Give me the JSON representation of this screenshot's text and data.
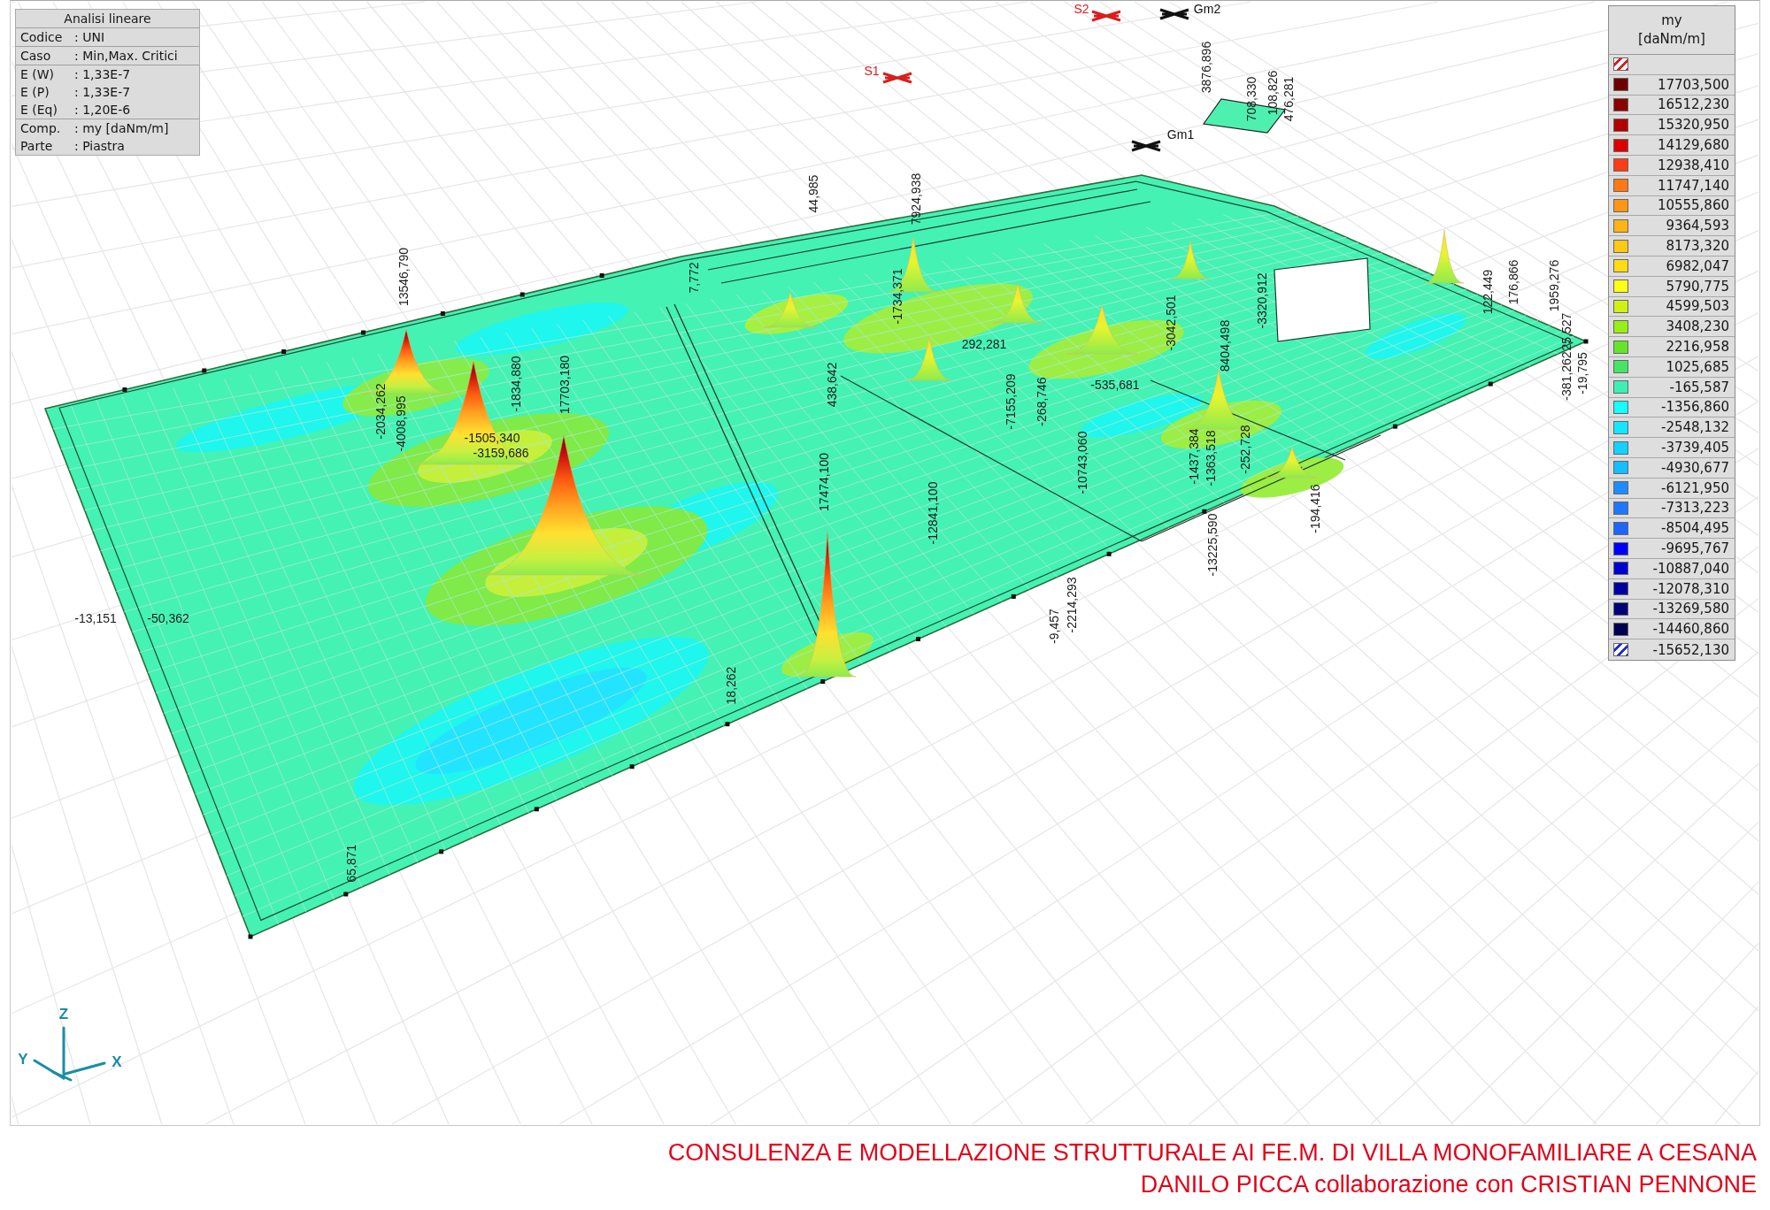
{
  "info_panel": {
    "title": "Analisi lineare",
    "groups": [
      [
        {
          "label": "Codice",
          "value": ": UNI"
        }
      ],
      [
        {
          "label": "Caso",
          "value": ": Min,Max. Critici"
        }
      ],
      [
        {
          "label": "E (W)",
          "value": ": 1,33E-7"
        },
        {
          "label": "E (P)",
          "value": ": 1,33E-7"
        },
        {
          "label": "E (Eq)",
          "value": ": 1,20E-6"
        }
      ],
      [
        {
          "label": "Comp.",
          "value": ": my [daNm/m]"
        },
        {
          "label": "Parte",
          "value": ": Piastra"
        }
      ]
    ]
  },
  "markers": [
    {
      "label": "S1",
      "color": "#d81e1e"
    },
    {
      "label": "S2",
      "color": "#d81e1e"
    },
    {
      "label": "Gm1",
      "color": "#111111"
    },
    {
      "label": "Gm2",
      "color": "#111111"
    }
  ],
  "value_labels": [
    "13546,790",
    "-2034,262",
    "-4008,995",
    "-1834,880",
    "17703,180",
    "-1505,340",
    "-3159,686",
    "-13,151",
    "-50,362",
    "65,871",
    "17474,100",
    "18,262",
    "438,642",
    "-12841,100",
    "7,772",
    "44,985",
    "7924,938",
    "-1734,371",
    "292,281",
    "-7155,209",
    "-268,746",
    "-535,681",
    "-10743,060",
    "-2214,293",
    "-9,457",
    "-3042,501",
    "8404,498",
    "-3320,912",
    "-1437,384",
    "-1363,518",
    "-252,728",
    "-13225,590",
    "-194,416",
    "3876,896",
    "708,330",
    "108,826",
    "476,281",
    "122,449",
    "176,866",
    "1959,276",
    "25,527",
    "-381,262",
    "-19,795"
  ],
  "legend": {
    "title": "my",
    "unit": "[daNm/m]",
    "entries": [
      {
        "kind": "hatched",
        "color": "#d42020"
      },
      {
        "kind": "solid",
        "color": "#6e0000",
        "value": "17703,500"
      },
      {
        "kind": "solid",
        "color": "#8c0000",
        "value": "16512,230"
      },
      {
        "kind": "solid",
        "color": "#b40000",
        "value": "15320,950"
      },
      {
        "kind": "solid",
        "color": "#dc0000",
        "value": "14129,680"
      },
      {
        "kind": "solid",
        "color": "#ff3c14",
        "value": "12938,410"
      },
      {
        "kind": "solid",
        "color": "#ff7814",
        "value": "11747,140"
      },
      {
        "kind": "solid",
        "color": "#ff9614",
        "value": "10555,860"
      },
      {
        "kind": "solid",
        "color": "#ffb414",
        "value": "9364,593"
      },
      {
        "kind": "solid",
        "color": "#ffc814",
        "value": "8173,320"
      },
      {
        "kind": "solid",
        "color": "#ffdc14",
        "value": "6982,047"
      },
      {
        "kind": "solid",
        "color": "#ffff14",
        "value": "5790,775"
      },
      {
        "kind": "solid",
        "color": "#d2f014",
        "value": "4599,503"
      },
      {
        "kind": "solid",
        "color": "#96f014",
        "value": "3408,230"
      },
      {
        "kind": "solid",
        "color": "#64e628",
        "value": "2216,958"
      },
      {
        "kind": "solid",
        "color": "#46e664",
        "value": "1025,685"
      },
      {
        "kind": "solid",
        "color": "#3cf0b4",
        "value": "-165,587"
      },
      {
        "kind": "solid",
        "color": "#14ffff",
        "value": "-1356,860"
      },
      {
        "kind": "solid",
        "color": "#14e6ff",
        "value": "-2548,132"
      },
      {
        "kind": "solid",
        "color": "#14d2ff",
        "value": "-3739,405"
      },
      {
        "kind": "solid",
        "color": "#14beff",
        "value": "-4930,677"
      },
      {
        "kind": "solid",
        "color": "#1e8cff",
        "value": "-6121,950"
      },
      {
        "kind": "solid",
        "color": "#1e78ff",
        "value": "-7313,223"
      },
      {
        "kind": "solid",
        "color": "#1e64ff",
        "value": "-8504,495"
      },
      {
        "kind": "solid",
        "color": "#0000ff",
        "value": "-9695,767"
      },
      {
        "kind": "solid",
        "color": "#0000d2",
        "value": "-10887,040"
      },
      {
        "kind": "solid",
        "color": "#0000a0",
        "value": "-12078,310"
      },
      {
        "kind": "solid",
        "color": "#000078",
        "value": "-13269,580"
      },
      {
        "kind": "solid",
        "color": "#000050",
        "value": "-14460,860"
      },
      {
        "kind": "hatched",
        "color": "#2030c8",
        "value": "-15652,130"
      }
    ]
  },
  "axes": [
    "Z",
    "Y",
    "X"
  ],
  "footer": [
    "CONSULENZA E MODELLAZIONE STRUTTURALE AI FE.M. DI VILLA MONOFAMILIARE A CESANA",
    "DANILO PICCA collaborazione con CRISTIAN PENNONE"
  ]
}
